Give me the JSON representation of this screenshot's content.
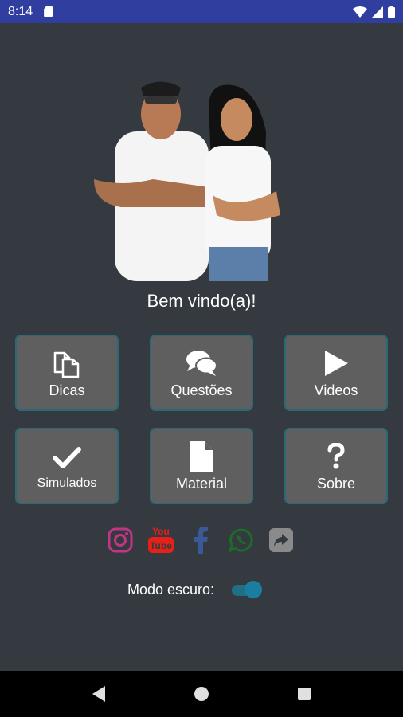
{
  "status_bar": {
    "time": "8:14",
    "icons": [
      "sim-card-icon",
      "wifi-icon",
      "signal-icon",
      "battery-icon"
    ]
  },
  "header": {
    "photo": "couple-portrait-image",
    "welcome": "Bem vindo(a)!"
  },
  "menu": {
    "items": [
      {
        "label": "Dicas",
        "icon": "copy-icon"
      },
      {
        "label": "Questões",
        "icon": "comments-icon"
      },
      {
        "label": "Videos",
        "icon": "play-icon"
      },
      {
        "label": "Simulados",
        "icon": "check-icon"
      },
      {
        "label": "Material",
        "icon": "file-icon"
      },
      {
        "label": "Sobre",
        "icon": "question-icon"
      }
    ]
  },
  "social": {
    "items": [
      {
        "name": "instagram-icon",
        "color": "#c13584"
      },
      {
        "name": "youtube-icon",
        "color": "#e62117",
        "text_top": "You",
        "text_bottom": "Tube"
      },
      {
        "name": "facebook-icon",
        "color": "#3b5998"
      },
      {
        "name": "whatsapp-icon",
        "color": "#1d6b2a"
      },
      {
        "name": "share-icon",
        "color": "#8a8a8a"
      }
    ]
  },
  "settings": {
    "dark_mode_label": "Modo escuro:",
    "dark_mode_on": true
  },
  "colors": {
    "background": "#353a40",
    "status_bar": "#303f9f",
    "button_bg": "#5f5f5f",
    "button_border": "#2a6a78",
    "toggle": "#1a7ea0"
  }
}
